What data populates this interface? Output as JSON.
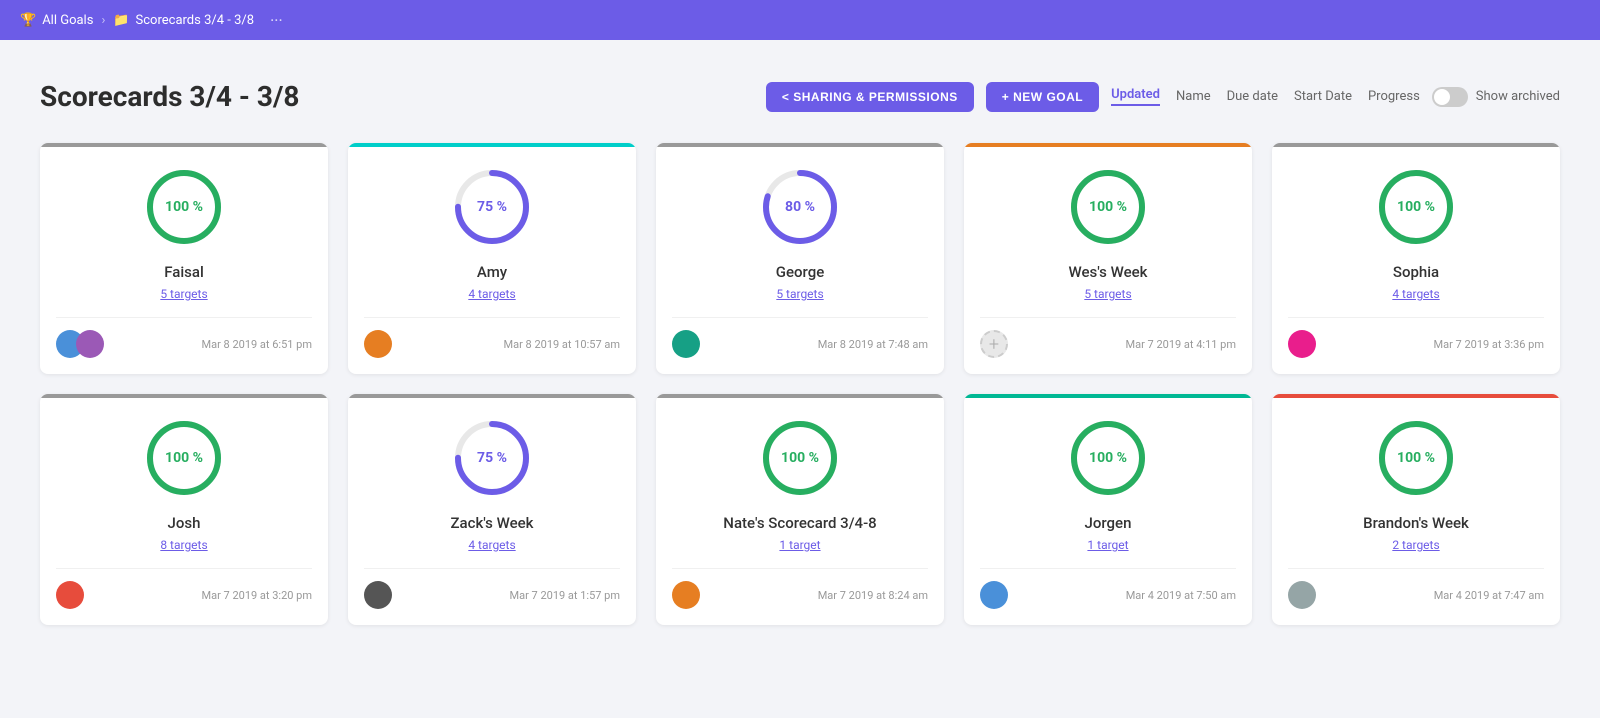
{
  "nav": {
    "all_goals": "All Goals",
    "current_folder": "Scorecards 3/4 - 3/8",
    "dots": "···"
  },
  "header": {
    "title": "Scorecards 3/4 - 3/8",
    "sharing_btn": "< SHARING & PERMISSIONS",
    "new_goal_btn": "+ NEW GOAL",
    "sort_options": [
      {
        "label": "Updated",
        "active": true
      },
      {
        "label": "Name",
        "active": false
      },
      {
        "label": "Due date",
        "active": false
      },
      {
        "label": "Start Date",
        "active": false
      },
      {
        "label": "Progress",
        "active": false
      }
    ],
    "show_archived": "Show archived"
  },
  "cards": [
    {
      "name": "Faisal",
      "targets": "5 targets",
      "progress": 100,
      "color": "green",
      "border": "border-gray",
      "date": "Mar 8 2019 at 6:51 pm",
      "avatar_color": "av-blue",
      "avatar2_color": "av-purple",
      "has_two_avatars": true
    },
    {
      "name": "Amy",
      "targets": "4 targets",
      "progress": 75,
      "color": "purple",
      "border": "border-cyan",
      "date": "Mar 8 2019 at 10:57 am",
      "avatar_color": "av-orange",
      "has_two_avatars": false
    },
    {
      "name": "George",
      "targets": "5 targets",
      "progress": 80,
      "color": "purple",
      "border": "border-gray",
      "date": "Mar 8 2019 at 7:48 am",
      "avatar_color": "av-teal",
      "has_two_avatars": false
    },
    {
      "name": "Wes's Week",
      "targets": "5 targets",
      "progress": 100,
      "color": "green",
      "border": "border-orange",
      "date": "Mar 7 2019 at 4:11 pm",
      "avatar_color": "av-gray",
      "has_two_avatars": false,
      "is_ghost_avatar": true
    },
    {
      "name": "Sophia",
      "targets": "4 targets",
      "progress": 100,
      "color": "green",
      "border": "border-gray",
      "date": "Mar 7 2019 at 3:36 pm",
      "avatar_color": "av-pink",
      "has_two_avatars": false
    },
    {
      "name": "Josh",
      "targets": "8 targets",
      "progress": 100,
      "color": "green",
      "border": "border-gray",
      "date": "Mar 7 2019 at 3:20 pm",
      "avatar_color": "av-red",
      "has_two_avatars": false
    },
    {
      "name": "Zack's Week",
      "targets": "4 targets",
      "progress": 75,
      "color": "purple",
      "border": "border-gray",
      "date": "Mar 7 2019 at 1:57 pm",
      "avatar_color": "av-dark",
      "has_two_avatars": false
    },
    {
      "name": "Nate's Scorecard 3/4-8",
      "targets": "1 target",
      "progress": 100,
      "color": "green",
      "border": "border-gray",
      "date": "Mar 7 2019 at 8:24 am",
      "avatar_color": "av-orange",
      "has_two_avatars": false
    },
    {
      "name": "Jorgen",
      "targets": "1 target",
      "progress": 100,
      "color": "green",
      "border": "border-teal",
      "date": "Mar 4 2019 at 7:50 am",
      "avatar_color": "av-blue",
      "has_two_avatars": false
    },
    {
      "name": "Brandon's Week",
      "targets": "2 targets",
      "progress": 100,
      "color": "green",
      "border": "border-red",
      "date": "Mar 4 2019 at 7:47 am",
      "avatar_color": "av-gray",
      "has_two_avatars": false
    }
  ]
}
